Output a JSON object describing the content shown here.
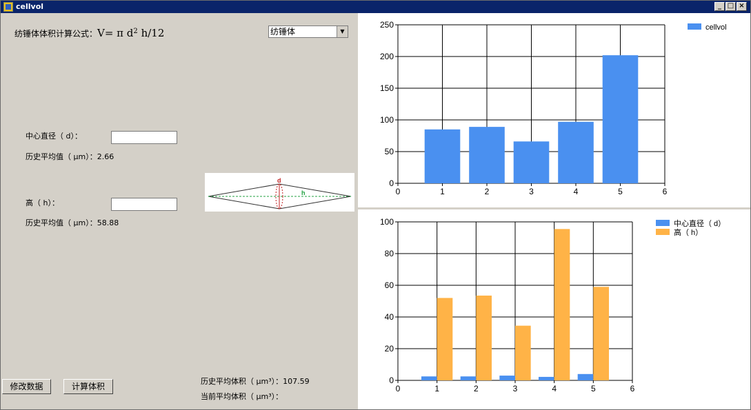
{
  "window": {
    "title": "cellvol"
  },
  "form": {
    "formula_label": "纺锤体体积计算公式：",
    "formula_text": "V= π d",
    "formula_exp": "2",
    "formula_tail": " h/12",
    "shape_select": "纺锤体",
    "diameter_label": "中心直径（ d）：",
    "diameter_value": "",
    "diameter_avg_label": "历史平均值（ μm）：",
    "diameter_avg_value": "2.66",
    "height_label": "高（ h）：",
    "height_value": "",
    "height_avg_label": "历史平均值（ μm）：",
    "height_avg_value": "58.88",
    "diagram_d": "d",
    "diagram_h": "h",
    "modify_button": "修改数据",
    "calc_button": "计算体积",
    "hist_volume_label": "历史平均体积（ μm³）：",
    "hist_volume_value": "107.59",
    "current_volume_label": "当前平均体积（ μm³）：",
    "current_volume_value": ""
  },
  "colors": {
    "blue": "#4a90f0",
    "orange": "#ffb347"
  },
  "chart_data": [
    {
      "type": "bar",
      "x": [
        1,
        2,
        3,
        4,
        5
      ],
      "series": [
        {
          "name": "cellvol",
          "values": [
            85,
            89,
            66,
            97,
            202
          ]
        }
      ],
      "xlim": [
        0,
        6
      ],
      "ylim": [
        0,
        250
      ],
      "xticks": [
        0,
        1,
        2,
        3,
        4,
        5,
        6
      ],
      "yticks": [
        0,
        50,
        100,
        150,
        200,
        250
      ],
      "grid": true,
      "legend": "top-right"
    },
    {
      "type": "bar",
      "x": [
        1,
        2,
        3,
        4,
        5
      ],
      "series": [
        {
          "name": "中心直径（ d）",
          "values": [
            2.5,
            2.5,
            3,
            2.2,
            4
          ]
        },
        {
          "name": "高（ h）",
          "values": [
            52,
            53.5,
            34.5,
            95.5,
            59
          ]
        }
      ],
      "xlim": [
        0,
        6
      ],
      "ylim": [
        0,
        100
      ],
      "xticks": [
        0,
        1,
        2,
        3,
        4,
        5,
        6
      ],
      "yticks": [
        0,
        20,
        40,
        60,
        80,
        100
      ],
      "grid": true,
      "legend": "top-right"
    }
  ]
}
